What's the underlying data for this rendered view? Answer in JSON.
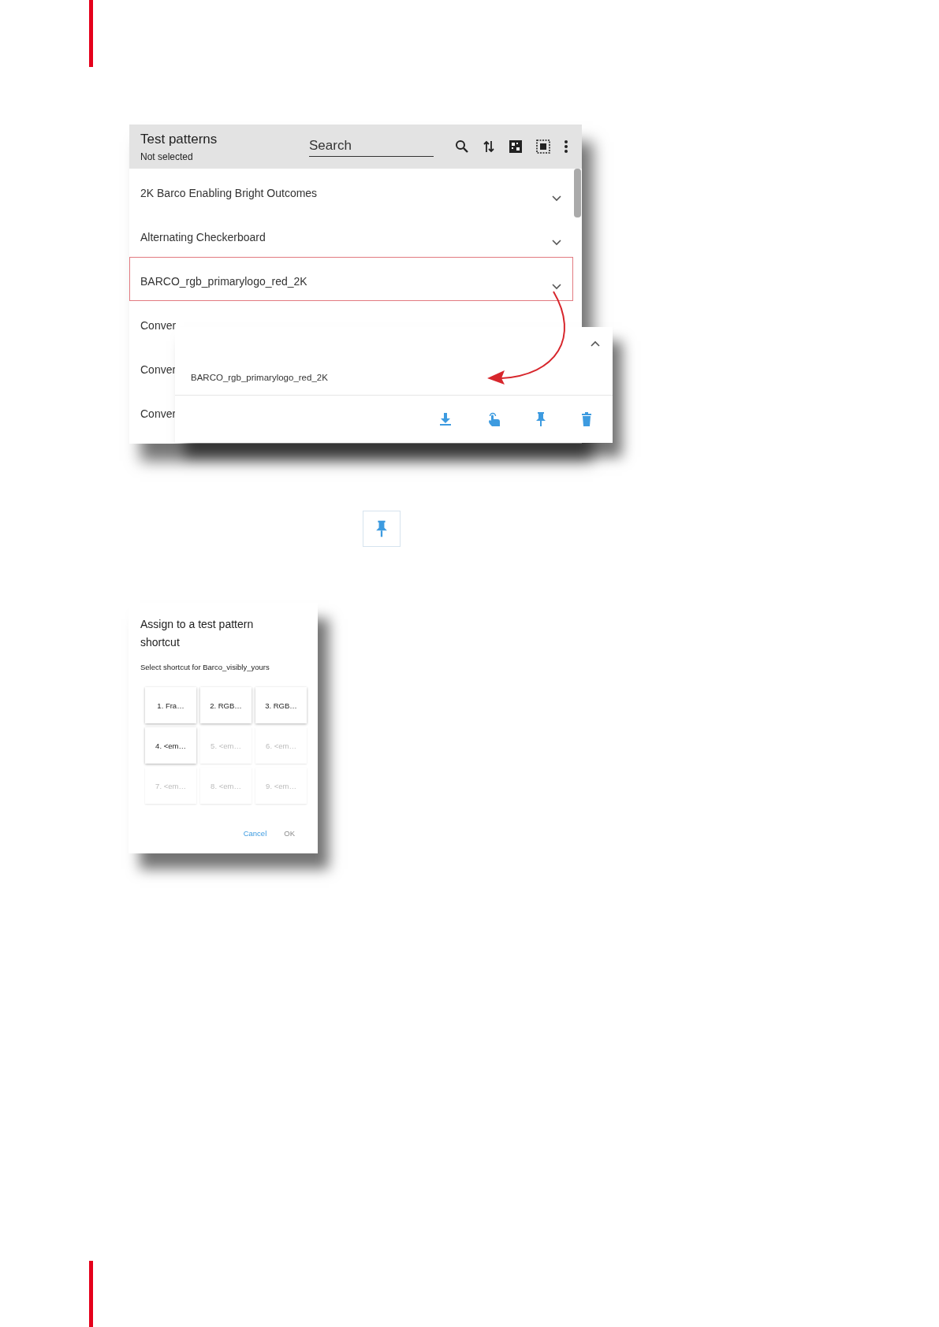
{
  "test_patterns_panel": {
    "title": "Test patterns",
    "subtitle": "Not selected",
    "search": {
      "placeholder": "Search"
    },
    "items": [
      {
        "label": "2K Barco Enabling Bright Outcomes",
        "selected": false,
        "chevron": true
      },
      {
        "label": "Alternating Checkerboard",
        "selected": false,
        "chevron": true
      },
      {
        "label": "BARCO_rgb_primarylogo_red_2K",
        "selected": true,
        "chevron": true
      },
      {
        "label": "Conver",
        "selected": false,
        "chevron": false
      },
      {
        "label": "Conver",
        "selected": false,
        "chevron": false
      },
      {
        "label": "Conver",
        "selected": false,
        "chevron": false
      }
    ],
    "expanded_item": {
      "label": "BARCO_rgb_primarylogo_red_2K",
      "expanded": true
    }
  },
  "assign_dialog": {
    "title": "Assign to a test pattern shortcut",
    "subtitle": "Select shortcut for Barco_visibly_yours",
    "shortcuts": [
      {
        "label": "1. Fra…",
        "disabled": false
      },
      {
        "label": "2. RGB…",
        "disabled": false
      },
      {
        "label": "3. RGB…",
        "disabled": false
      },
      {
        "label": "4. <em…",
        "disabled": false
      },
      {
        "label": "5. <em…",
        "disabled": true
      },
      {
        "label": "6. <em…",
        "disabled": true
      },
      {
        "label": "7. <em…",
        "disabled": true
      },
      {
        "label": "8. <em…",
        "disabled": true
      },
      {
        "label": "9. <em…",
        "disabled": true
      }
    ],
    "buttons": [
      {
        "label": "Cancel",
        "disabled": false
      },
      {
        "label": "OK",
        "disabled": true
      }
    ]
  }
}
